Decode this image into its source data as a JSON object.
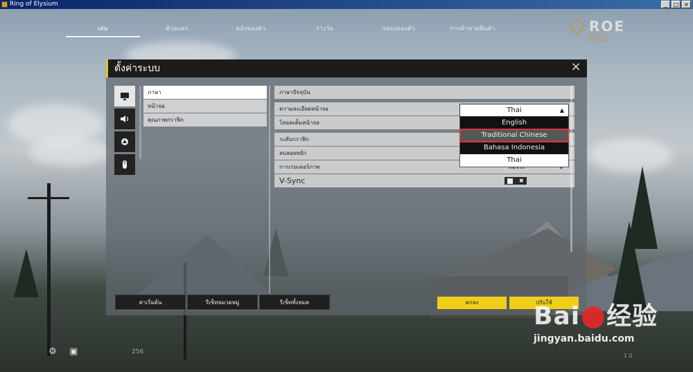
{
  "window": {
    "title": "Ring of Elysium",
    "buttons": [
      "_",
      "□",
      "×"
    ]
  },
  "topnav": {
    "items": [
      {
        "label": "เล่น"
      },
      {
        "label": "ตัวละคร"
      },
      {
        "label": "คลังของตัว"
      },
      {
        "label": "รางวัล"
      },
      {
        "label": "กล่องของตัว"
      },
      {
        "label": "การค้าขายสินค้า"
      }
    ]
  },
  "logo": {
    "text": "ROE",
    "sub": "RING OF ELYSIUM"
  },
  "dialog": {
    "title": "ตั้งค่าระบบ",
    "close": "×",
    "vtabs": [
      "monitor-icon",
      "speaker-icon",
      "gamepad-icon",
      "mouse-icon"
    ],
    "categories": [
      {
        "label": "ภาษา"
      },
      {
        "label": "หน้าจอ"
      },
      {
        "label": "คุณภาพกราฟิก"
      }
    ],
    "rows": [
      {
        "label": "ภาษาปัจจุบัน"
      },
      {
        "label": "ความละเอียดหน้าจอ"
      },
      {
        "label": "โหมดเต็มหน้าจอ"
      },
      {
        "label": "ระดับกราฟิก"
      },
      {
        "label": "ลบลอยหยัก"
      },
      {
        "label": "การเรนเดอร์ภาพ",
        "value": "สมจริง"
      },
      {
        "label": "V-Sync"
      }
    ],
    "dropdown": {
      "selected": "Thai",
      "options": [
        "English",
        "Traditional Chinese",
        "Bahasa Indonesia",
        "Thai"
      ]
    },
    "buttons": {
      "reset_default": "ค่าเริ่มต้น",
      "reset_category": "รีเซ็ทหมวดหมู่",
      "reset_all": "รีเซ็ททั้งหมด",
      "ok": "ตกลง",
      "apply": "ปรับใช้"
    }
  },
  "hud": {
    "count": "256"
  },
  "watermark": {
    "logo_left": "Bai",
    "logo_right": "经验",
    "url": "jingyan.baidu.com"
  },
  "version": "1.0"
}
